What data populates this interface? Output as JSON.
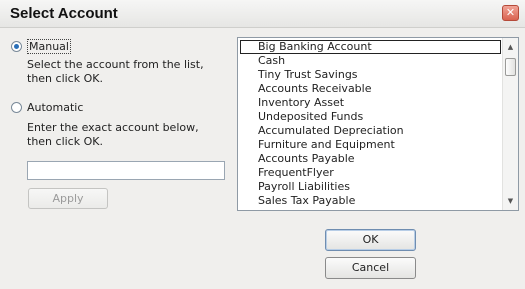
{
  "dialog": {
    "title": "Select Account",
    "close_glyph": "✕"
  },
  "manual": {
    "label": "Manual",
    "selected": true,
    "help": "Select the account from the list, then click OK."
  },
  "automatic": {
    "label": "Automatic",
    "selected": false,
    "help": "Enter the exact account below, then click OK.",
    "input_value": "",
    "apply_label": "Apply"
  },
  "accounts": {
    "selected_index": 0,
    "items": [
      "Big Banking Account",
      "Cash",
      "Tiny Trust Savings",
      "Accounts Receivable",
      "Inventory Asset",
      "Undeposited Funds",
      "Accumulated Depreciation",
      "Furniture and Equipment",
      "Accounts Payable",
      "FrequentFlyer",
      "Payroll Liabilities",
      "Sales Tax Payable"
    ]
  },
  "buttons": {
    "ok_label": "OK",
    "cancel_label": "Cancel"
  },
  "icons": {
    "close": "close-icon",
    "scroll_up": "scroll-up-arrow-icon",
    "scroll_down": "scroll-down-arrow-icon"
  },
  "colors": {
    "close_button": "#d9624f",
    "radio_selected": "#2a6fb8"
  }
}
